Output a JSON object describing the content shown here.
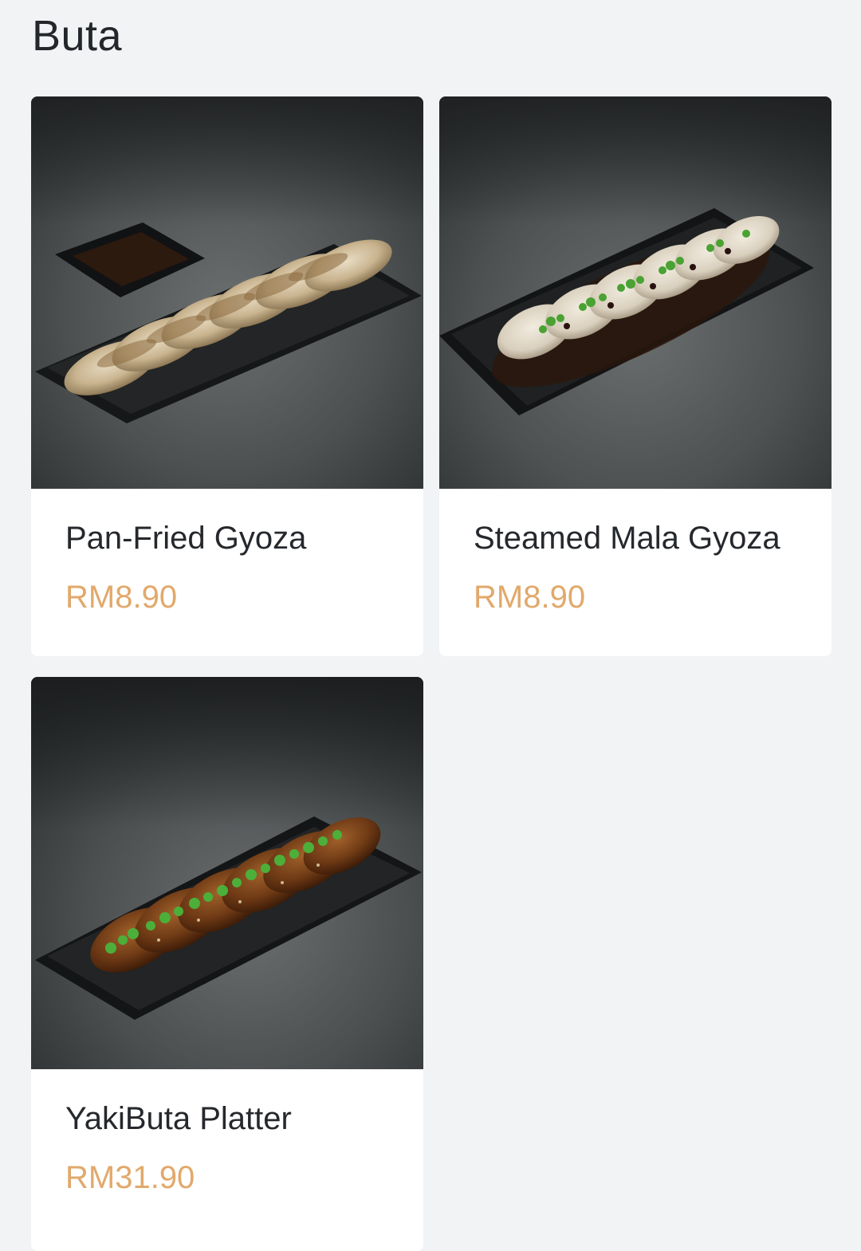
{
  "section": {
    "title": "Buta"
  },
  "items": [
    {
      "name": "Pan-Fried Gyoza",
      "price": "RM8.90",
      "image_icon": "gyoza-photo"
    },
    {
      "name": "Steamed Mala Gyoza",
      "price": "RM8.90",
      "image_icon": "mala-gyoza-photo"
    },
    {
      "name": "YakiButa Platter",
      "price": "RM31.90",
      "image_icon": "yakibuta-photo"
    }
  ],
  "colors": {
    "background": "#f2f3f5",
    "card": "#ffffff",
    "title_text": "#23262b",
    "price_text": "#e1a96b"
  }
}
